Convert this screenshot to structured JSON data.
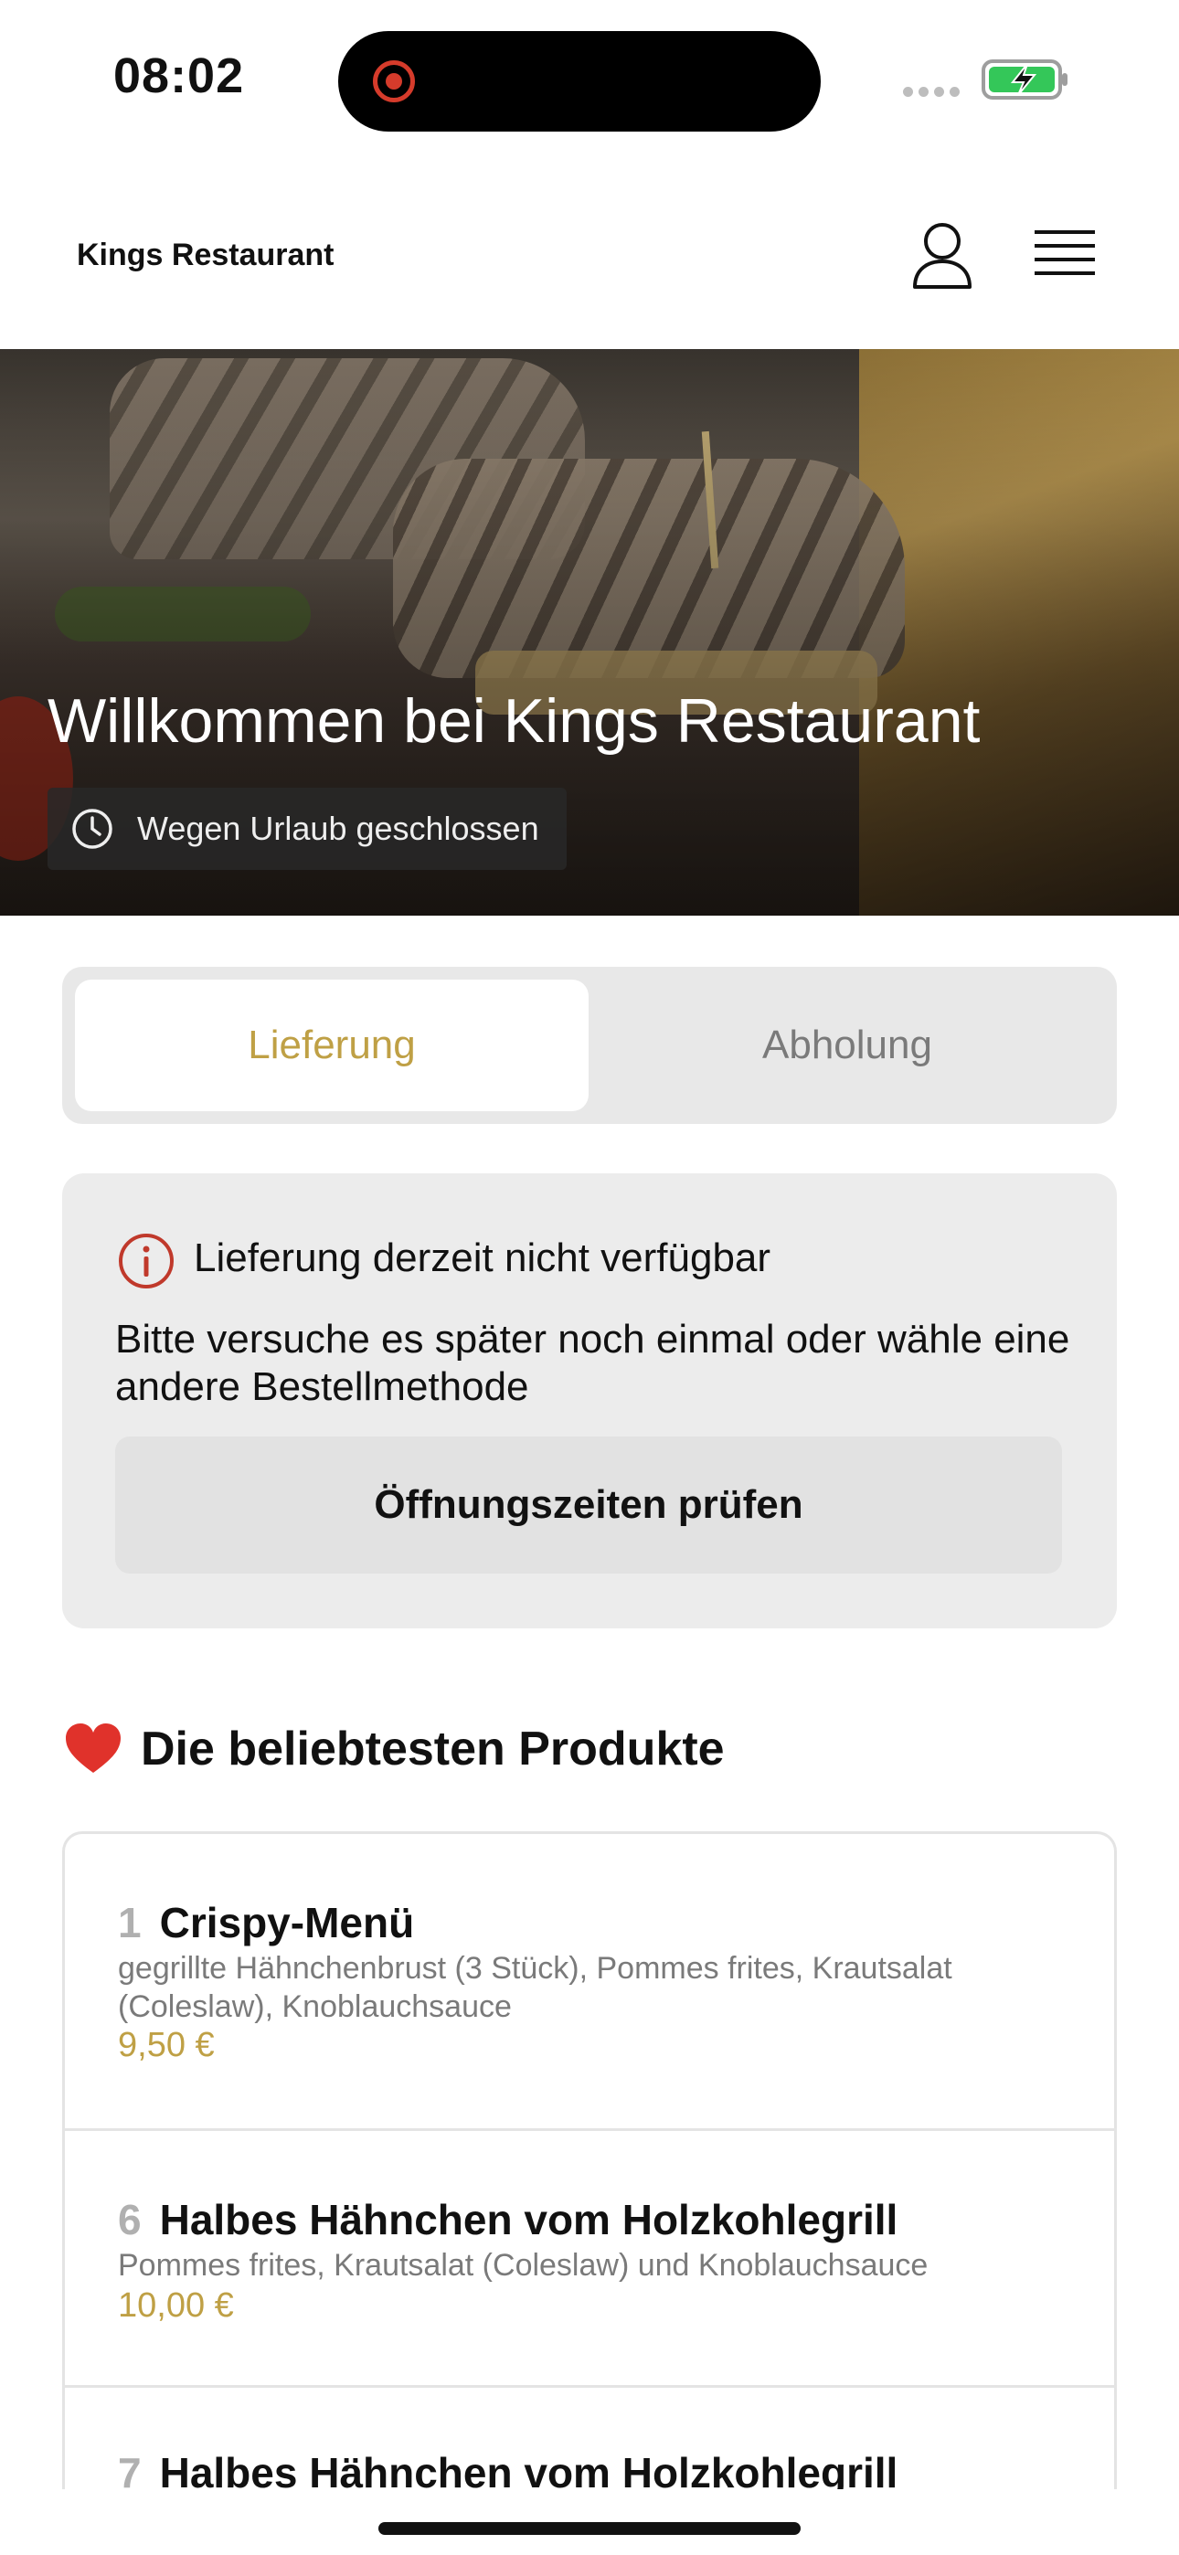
{
  "status_bar": {
    "time": "08:02"
  },
  "header": {
    "title": "Kings Restaurant"
  },
  "hero": {
    "title": "Willkommen bei Kings Restaurant",
    "status": "Wegen Urlaub geschlossen"
  },
  "tabs": [
    {
      "label": "Lieferung",
      "selected": true
    },
    {
      "label": "Abholung",
      "selected": false
    }
  ],
  "notice": {
    "title": "Lieferung derzeit nicht verfügbar",
    "text": "Bitte versuche es später noch einmal oder wähle eine andere Bestellmethode",
    "button": "Öffnungszeiten prüfen"
  },
  "popular": {
    "heading": "Die beliebtesten Produkte",
    "products": [
      {
        "number": "1",
        "name": "Crispy-Menü",
        "description": "gegrillte Hähnchenbrust (3 Stück), Pommes frites, Krautsalat (Coleslaw), Knoblauchsauce",
        "price": "9,50 €"
      },
      {
        "number": "6",
        "name": "Halbes Hähnchen vom Holzkohlegrill",
        "description": "Pommes frites, Krautsalat (Coleslaw) und Knoblauchsauce",
        "price": "10,00 €"
      },
      {
        "number": "7",
        "name": "Halbes Hähnchen vom Holzkohlegrill",
        "description": "",
        "price": ""
      }
    ]
  },
  "colors": {
    "accent": "#bfa045",
    "alert": "#c0392b"
  }
}
